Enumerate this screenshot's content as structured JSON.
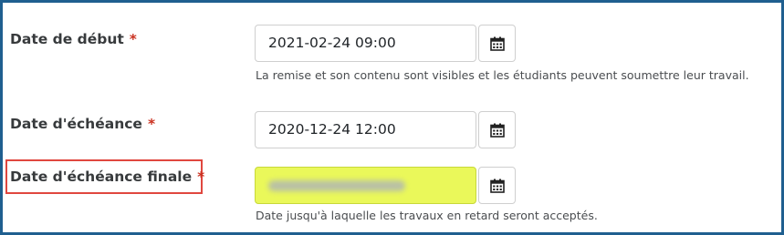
{
  "fields": [
    {
      "label": "Date de début",
      "required_marker": "*",
      "value": "2021-02-24 09:00",
      "help": "La remise et son contenu sont visibles et les étudiants peuvent soumettre leur travail.",
      "calendar_icon": "calendar-icon"
    },
    {
      "label": "Date d'échéance",
      "required_marker": "*",
      "value": "2020-12-24 12:00",
      "calendar_icon": "calendar-icon"
    },
    {
      "label": "Date d'échéance finale",
      "required_marker": "*",
      "value": "",
      "value_obscured": true,
      "highlight_color": "#eaf85a",
      "label_outline_color": "#e0473f",
      "help": "Date jusqu'à laquelle les travaux en retard seront acceptés.",
      "calendar_icon": "calendar-icon"
    }
  ],
  "colors": {
    "frame_border": "#1f5f8f",
    "required": "#ca3120"
  }
}
